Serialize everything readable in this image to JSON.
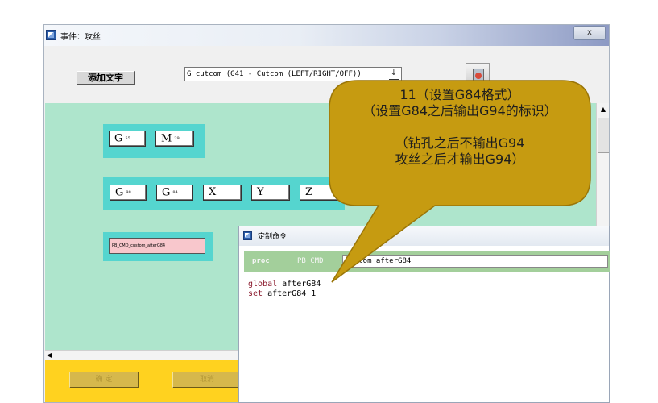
{
  "window": {
    "title": "事件：攻丝",
    "close_label": "x"
  },
  "toolbar": {
    "add_text_label": "添加文字",
    "dropdown_value": "G_cutcom (G41 - Cutcom (LEFT/RIGHT/OFF))",
    "dropdown_arrow": "↓"
  },
  "canvas": {
    "row1": [
      {
        "letter": "G",
        "sub": "55"
      },
      {
        "letter": "M",
        "sub": "29"
      }
    ],
    "row2": [
      {
        "letter": "G",
        "sub": "98"
      },
      {
        "letter": "G",
        "sub": "84"
      },
      {
        "letter": "X",
        "sub": ""
      },
      {
        "letter": "Y",
        "sub": ""
      },
      {
        "letter": "Z",
        "sub": ""
      }
    ],
    "custom_block": "PB_CMD_custom_afterG84"
  },
  "bottom_bar": {
    "btn1": "确 定",
    "btn2": "取消"
  },
  "dialog": {
    "title": "定制命令",
    "proc_keyword": "proc",
    "proc_prefix": "PB_CMD_",
    "proc_name": "custom_afterG84",
    "code_lines": [
      {
        "kw": "global",
        "rest": " afterG84"
      },
      {
        "kw": "set",
        "rest": " afterG84 1"
      }
    ]
  },
  "callout": {
    "line1": "11（设置G84格式）",
    "line2": "（设置G84之后输出G94的标识）",
    "line3": "（钻孔之后不输出G94",
    "line4": "攻丝之后才输出G94）",
    "fill": "#c69b11",
    "stroke": "#9a7508"
  },
  "colors": {
    "canvas": "#aee5cc",
    "group": "#55d5cf",
    "yellow": "#ffd21f"
  }
}
